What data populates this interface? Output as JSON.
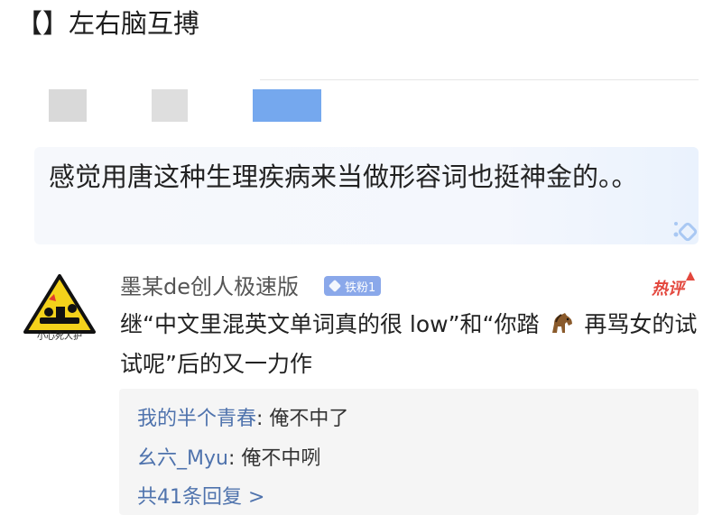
{
  "topic": {
    "text": "【】左右脑互搏"
  },
  "quote": {
    "text": "感觉用唐这种生理疾病来当做形容词也挺神金的。。"
  },
  "comment": {
    "username": "墨某de创人极速版",
    "fan_badge": "铁粉1",
    "hot_tag": "热评",
    "avatar_caption": "小心死人护",
    "body_part1": "继“中文里混英文单词真的很 low”和“你踏",
    "body_icon": "horse-icon",
    "body_part2": "再骂女的试试呢”后的又一力作"
  },
  "replies": [
    {
      "user": "我的半个青春",
      "text": ": 俺不中了"
    },
    {
      "user": "幺六_Myu",
      "text": ": 俺不中咧"
    }
  ],
  "more_replies": "共41条回复 >",
  "colors": {
    "link_blue": "#4f73ad",
    "badge_blue": "#8aa8ea",
    "hot_red": "#e3473d",
    "blur_blue": "#75a8ee"
  }
}
